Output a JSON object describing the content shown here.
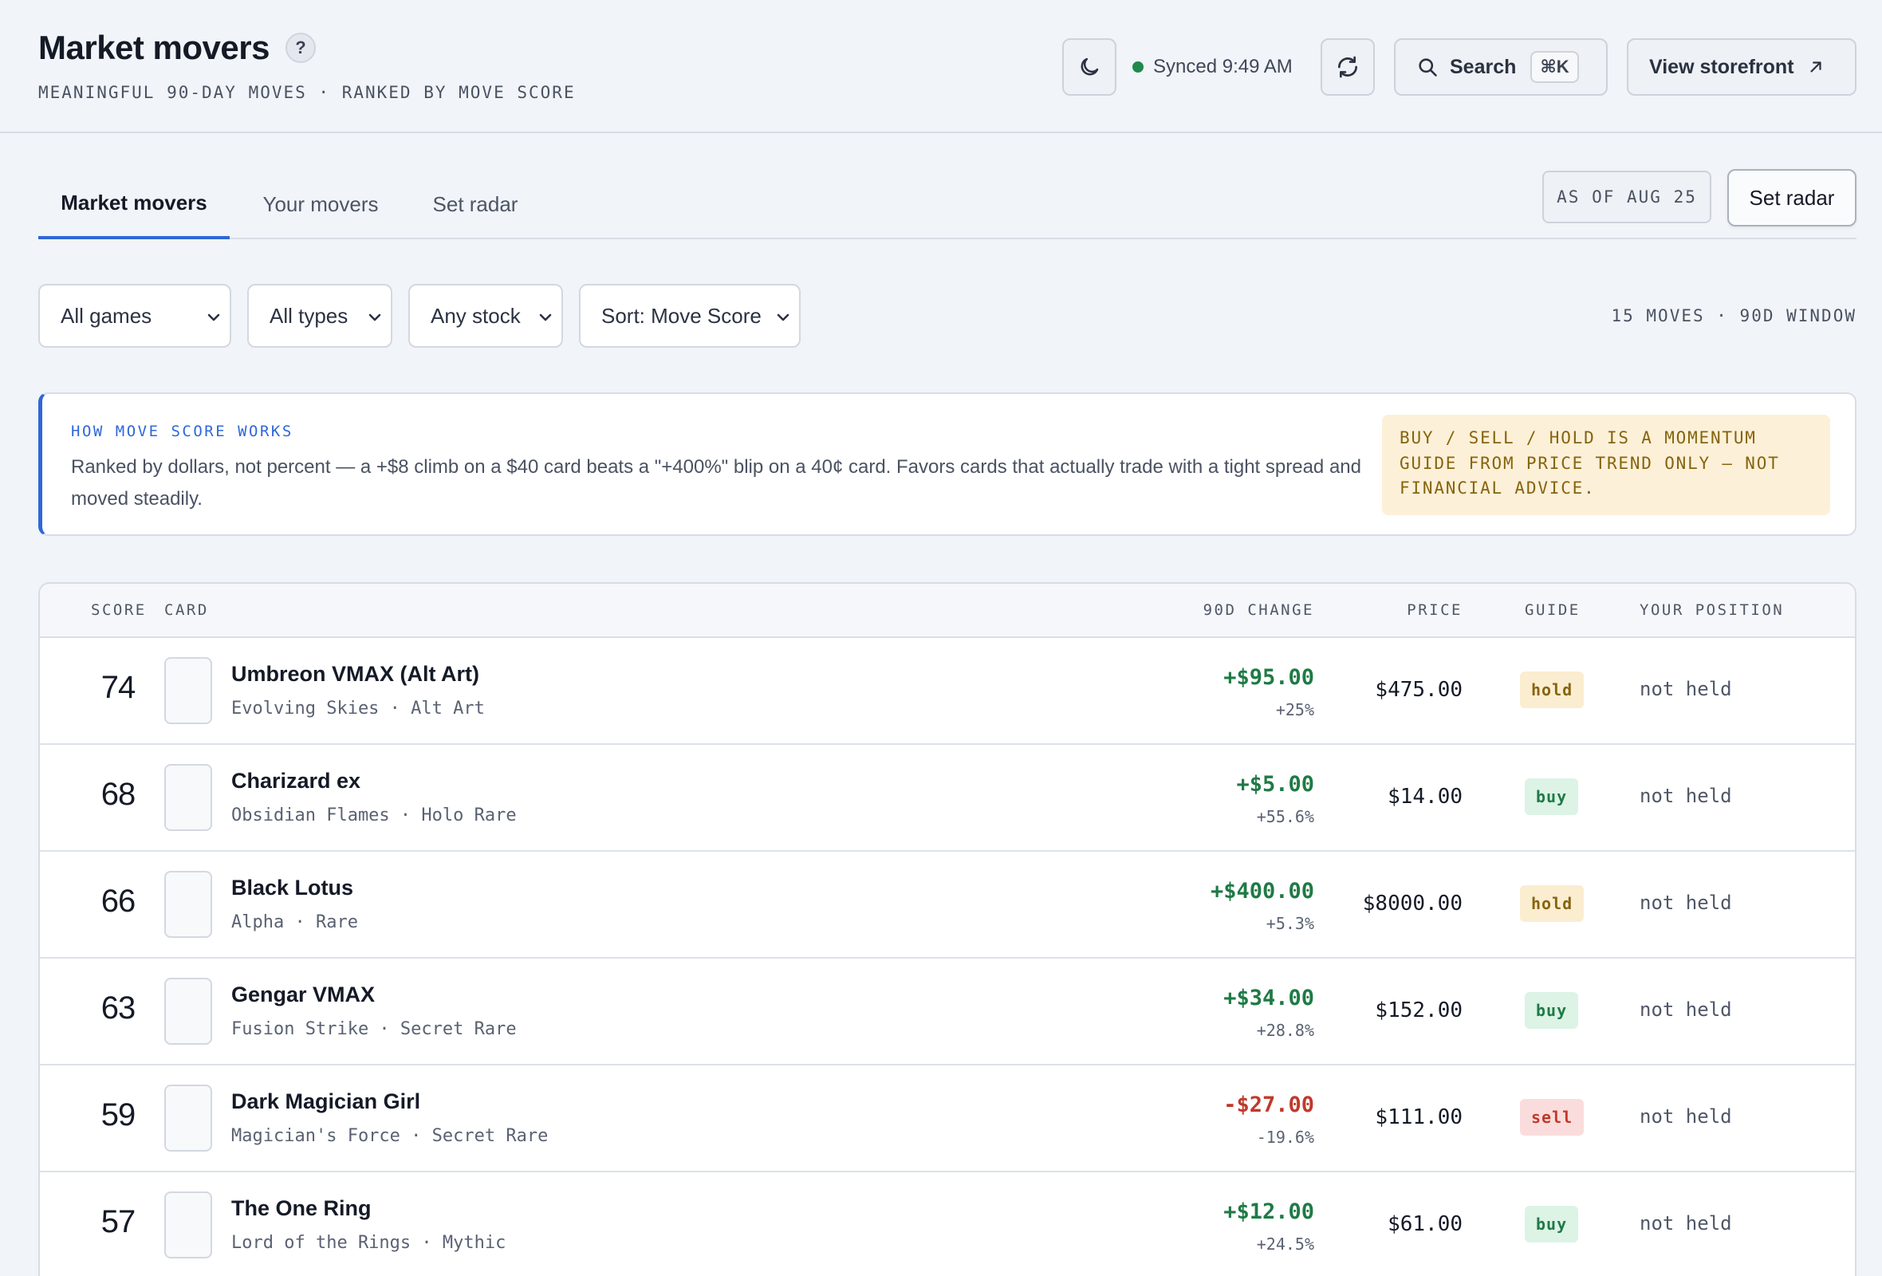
{
  "header": {
    "title": "Market movers",
    "help_label": "?",
    "subtitle": "MEANINGFUL 90-DAY MOVES · RANKED BY MOVE SCORE",
    "sync_status": "Synced 9:49 AM",
    "search_label": "Search",
    "search_shortcut": "⌘K",
    "storefront_label": "View storefront"
  },
  "tabs": [
    {
      "label": "Market movers",
      "active": true
    },
    {
      "label": "Your movers",
      "active": false
    },
    {
      "label": "Set radar",
      "active": false
    }
  ],
  "as_of": "AS OF AUG 25",
  "set_radar_button": "Set radar",
  "filters": {
    "game": "All games",
    "type": "All types",
    "stock": "Any stock",
    "sort": "Sort: Move Score"
  },
  "moves_count": "15 MOVES · 90D WINDOW",
  "info": {
    "heading": "HOW MOVE SCORE WORKS",
    "text": "Ranked by dollars, not percent — a +$8 climb on a $40 card beats a \"+400%\" blip on a 40¢ card. Favors cards that actually trade with a tight spread and moved steadily.",
    "disclaimer": "BUY / SELL / HOLD IS A MOMENTUM GUIDE FROM PRICE TREND ONLY — NOT FINANCIAL ADVICE."
  },
  "table": {
    "headers": {
      "score": "SCORE",
      "card": "CARD",
      "change": "90D CHANGE",
      "price": "PRICE",
      "guide": "GUIDE",
      "position": "YOUR POSITION"
    },
    "rows": [
      {
        "score": "74",
        "name": "Umbreon VMAX (Alt Art)",
        "meta": "Evolving Skies · Alt Art",
        "change": "+$95.00",
        "pct": "+25%",
        "price": "$475.00",
        "guide": "hold",
        "position": "not held"
      },
      {
        "score": "68",
        "name": "Charizard ex",
        "meta": "Obsidian Flames · Holo Rare",
        "change": "+$5.00",
        "pct": "+55.6%",
        "price": "$14.00",
        "guide": "buy",
        "position": "not held"
      },
      {
        "score": "66",
        "name": "Black Lotus",
        "meta": "Alpha · Rare",
        "change": "+$400.00",
        "pct": "+5.3%",
        "price": "$8000.00",
        "guide": "hold",
        "position": "not held"
      },
      {
        "score": "63",
        "name": "Gengar VMAX",
        "meta": "Fusion Strike · Secret Rare",
        "change": "+$34.00",
        "pct": "+28.8%",
        "price": "$152.00",
        "guide": "buy",
        "position": "not held"
      },
      {
        "score": "59",
        "name": "Dark Magician Girl",
        "meta": "Magician's Force · Secret Rare",
        "change": "-$27.00",
        "pct": "-19.6%",
        "price": "$111.00",
        "guide": "sell",
        "position": "not held"
      },
      {
        "score": "57",
        "name": "The One Ring",
        "meta": "Lord of the Rings · Mythic",
        "change": "+$12.00",
        "pct": "+24.5%",
        "price": "$61.00",
        "guide": "buy",
        "position": "not held"
      }
    ]
  },
  "colors": {
    "accent": "#2f67d8",
    "positive": "#1f7a45",
    "negative": "#c0392b",
    "sync_dot": "#1f8a4c"
  },
  "icons": {
    "theme": "moon-icon",
    "refresh": "refresh-icon",
    "search": "search-icon",
    "external": "arrow-up-right-icon",
    "dropdown": "chevron-down-icon"
  }
}
